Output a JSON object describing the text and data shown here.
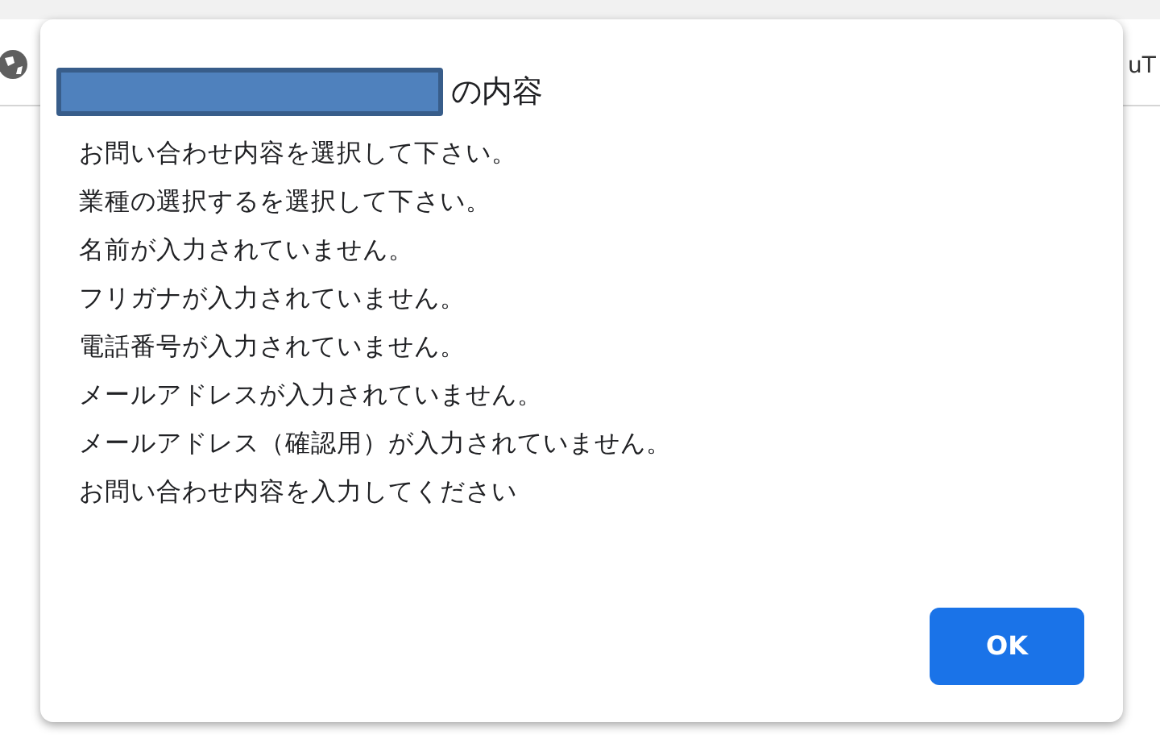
{
  "background": {
    "tab_text": "uT"
  },
  "dialog": {
    "title_suffix": "の内容",
    "messages": [
      "お問い合わせ内容を選択して下さい。",
      "業種の選択するを選択して下さい。",
      "名前が入力されていません。",
      "フリガナが入力されていません。",
      "電話番号が入力されていません。",
      "メールアドレスが入力されていません。",
      "メールアドレス（確認用）が入力されていません。",
      "お問い合わせ内容を入力してください"
    ],
    "buttons": [
      {
        "label": "OK"
      }
    ]
  }
}
